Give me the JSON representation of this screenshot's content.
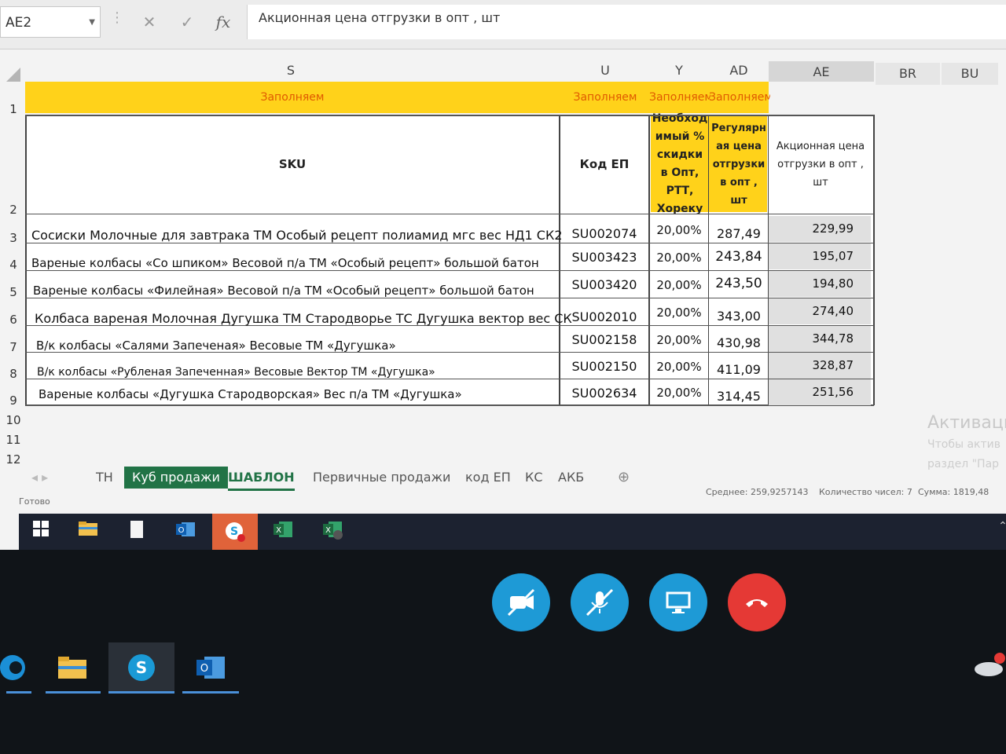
{
  "formula_bar": {
    "name_box": "AE2",
    "cancel_icon": "✕",
    "enter_icon": "✓",
    "fx_label": "fx",
    "formula": "Акционная цена отгрузки в опт , шт"
  },
  "columns": {
    "S": "S",
    "U": "U",
    "Y": "Y",
    "AD": "AD",
    "AE": "AE",
    "BR": "BR",
    "BU": "BU"
  },
  "row_numbers": [
    "1",
    "2",
    "3",
    "4",
    "5",
    "6",
    "7",
    "8",
    "9",
    "10",
    "11",
    "12"
  ],
  "row1": {
    "s": "Заполняем",
    "u": "Заполняем",
    "y": "Заполняем",
    "ad": "Заполняем"
  },
  "headers": {
    "sku": "SKU",
    "code": "Код ЕП",
    "discount": "Необход имый % скидки в Опт, РТТ, Хореку",
    "regular": "Регулярн ая цена отгрузки в опт , шт",
    "promo": "Акционная цена отгрузки в опт , шт"
  },
  "rows": [
    {
      "sku": "Сосиски Молочные для завтрака ТМ Особый рецепт полиамид мгс вес НД1 СК2",
      "code": "SU002074",
      "pct": "20,00%",
      "reg": "287,49",
      "ae": "229,99"
    },
    {
      "sku": "Вареные колбасы «Со шпиком» Весовой п/а ТМ «Особый рецепт» большой батон",
      "code": "SU003423",
      "pct": "20,00%",
      "reg": "243,84",
      "ae": "195,07"
    },
    {
      "sku": "Вареные колбасы «Филейная» Весовой п/а ТМ «Особый рецепт» большой батон",
      "code": "SU003420",
      "pct": "20,00%",
      "reg": "243,50",
      "ae": "194,80"
    },
    {
      "sku": "Колбаса вареная Молочная Дугушка ТМ Стародворье ТС Дугушка вектор вес СК",
      "code": "SU002010",
      "pct": "20,00%",
      "reg": "343,00",
      "ae": "274,40"
    },
    {
      "sku": "В/к колбасы «Салями Запеченая» Весовые ТМ «Дугушка»",
      "code": "SU002158",
      "pct": "20,00%",
      "reg": "430,98",
      "ae": "344,78"
    },
    {
      "sku": "В/к колбасы «Рубленая Запеченная» Весовые Вектор ТМ «Дугушка»",
      "code": "SU002150",
      "pct": "20,00%",
      "reg": "411,09",
      "ae": "328,87"
    },
    {
      "sku": "Вареные колбасы «Дугушка Стародворская» Вес п/а ТМ «Дугушка»",
      "code": "SU002634",
      "pct": "20,00%",
      "reg": "314,45",
      "ae": "251,56"
    }
  ],
  "watermark": {
    "line1": "Активаци",
    "line2": "Чтобы актив",
    "line3": "раздел \"Пар"
  },
  "sheet_tabs": [
    "ТН",
    "Куб продажи",
    "ШАБЛОН",
    "Первичные продажи",
    "код ЕП",
    "КС",
    "АКБ"
  ],
  "add_sheet_icon": "⊕",
  "status_bar": {
    "ready": "Готово",
    "average": "Среднее: 259,9257143",
    "count": "Количество чисел: 7",
    "sum": "Сумма: 1819,48"
  },
  "taskbar_icons": [
    "windows-icon",
    "file-explorer-icon",
    "document-icon",
    "outlook-icon",
    "skype-icon",
    "excel-icon",
    "excel-icon"
  ],
  "call_controls": [
    "video-off-icon",
    "mic-off-icon",
    "screen-share-icon",
    "hang-up-icon"
  ],
  "colors": {
    "header_yellow": "#ffd21a",
    "fill_text": "#e05a00",
    "excel_green": "#217346",
    "hangup_red": "#e53935",
    "call_blue": "#1e9ad6"
  }
}
